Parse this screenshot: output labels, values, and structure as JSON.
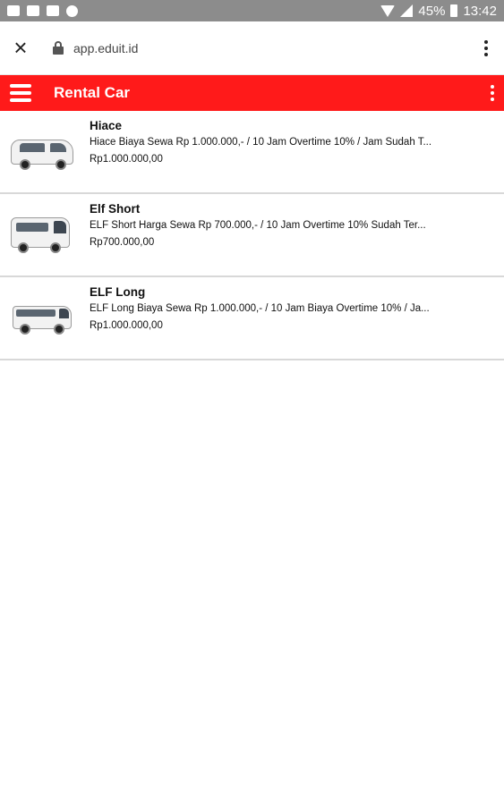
{
  "status_bar": {
    "battery": "45%",
    "time": "13:42"
  },
  "browser": {
    "url": "app.eduit.id",
    "close_symbol": "×"
  },
  "header": {
    "title": "Rental Car"
  },
  "items": [
    {
      "title": "Hiace",
      "description": "Hiace Biaya Sewa Rp 1.000.000,- / 10 Jam Overtime 10% / Jam Sudah T...",
      "price": "Rp1.000.000,00",
      "thumb_icon": "hiace-van-image"
    },
    {
      "title": "Elf Short",
      "description": "ELF Short Harga Sewa Rp 700.000,- / 10 Jam Overtime 10% Sudah Ter...",
      "price": "Rp700.000,00",
      "thumb_icon": "elf-short-van-image"
    },
    {
      "title": "ELF Long",
      "description": "ELF Long Biaya Sewa Rp 1.000.000,- / 10 Jam Biaya Overtime 10% / Ja...",
      "price": "Rp1.000.000,00",
      "thumb_icon": "elf-long-van-image"
    }
  ],
  "colors": {
    "accent": "#ff1a1a",
    "status_bar": "#8c8c8c"
  }
}
